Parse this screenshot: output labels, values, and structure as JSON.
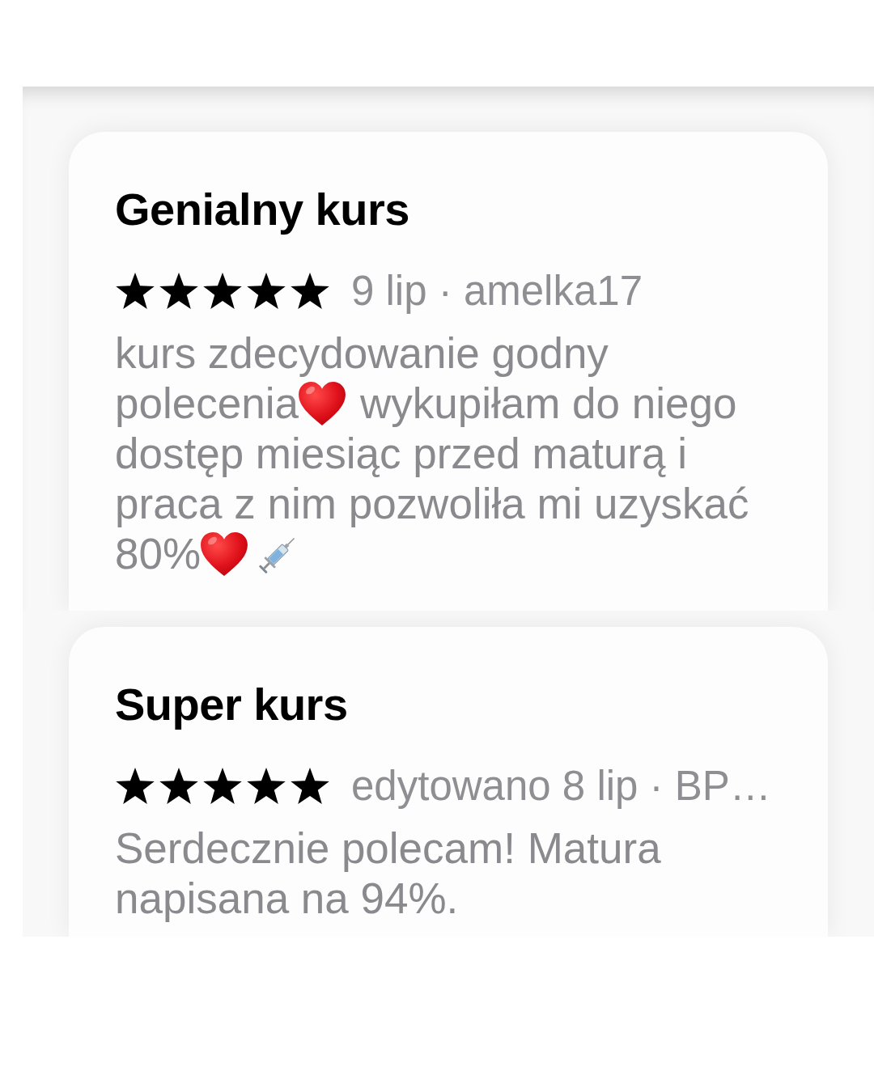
{
  "reviews": [
    {
      "title": "Genialny kurs",
      "stars": 5,
      "meta": "9 lip · amelka17",
      "body": [
        {
          "kind": "text",
          "text": "kurs zdecydowanie godny polecenia"
        },
        {
          "kind": "heart"
        },
        {
          "kind": "text",
          "text": "wykupiłam do niego dostęp miesiąc przed maturą i praca z nim pozwoliła mi uzyskać 80%"
        },
        {
          "kind": "heart"
        },
        {
          "kind": "syringe"
        }
      ]
    },
    {
      "title": "Super kurs",
      "stars": 5,
      "meta": "edytowano 8 lip · BP…",
      "body": [
        {
          "kind": "text",
          "text": "Serdecznie polecam! Matura napisana na 94%."
        }
      ]
    }
  ]
}
